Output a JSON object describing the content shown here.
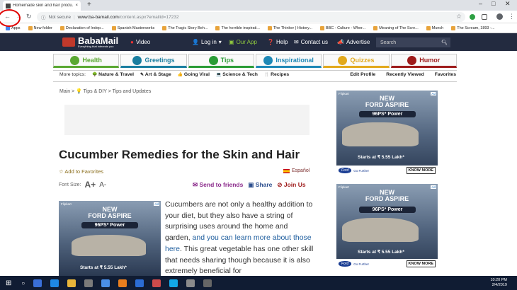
{
  "browser": {
    "tab_title": "Homemade skin and hair produ...",
    "new_tab_symbol": "+",
    "not_secure": "Not secure",
    "url_domain": "www.ba-bamail.com",
    "url_path": "/content.aspx?emailid=17232",
    "bookmarks": [
      "Apps",
      "New folder",
      "Declaration of Indep...",
      "Spanish Masterworks",
      "The Tragic Story Beh...",
      "The horrible inspirati...",
      "The Thinker | History...",
      "BBC - Culture - Wher...",
      "Meaning of The Scre...",
      "Munch",
      "The Scream, 1893 -..."
    ]
  },
  "site": {
    "logo_name": "BabaMail",
    "logo_tagline": "Everything that interests you",
    "video": "Video",
    "login": "Log in",
    "our_app": "Our App",
    "help": "Help",
    "contact": "Contact us",
    "advertise": "Advertise",
    "search_placeholder": "Search",
    "categories": [
      {
        "label": "Health",
        "color": "#5aa832"
      },
      {
        "label": "Greetings",
        "color": "#1a7ea0"
      },
      {
        "label": "Tips",
        "color": "#2a9c36"
      },
      {
        "label": "Inspirational",
        "color": "#1e88b6"
      },
      {
        "label": "Quizzes",
        "color": "#e2a91c"
      },
      {
        "label": "Humor",
        "color": "#9e1b1b"
      }
    ],
    "more_topics_label": "More topics:",
    "more_topics": [
      "Nature & Travel",
      "Art & Stage",
      "Going Viral",
      "Science & Tech",
      "Recipes"
    ],
    "account_links": [
      "Edit Profile",
      "Recently Viewed",
      "Favorites"
    ]
  },
  "article": {
    "breadcrumb": "Main > 💡 Tips & DIY > Tips and Updates",
    "title": "Cucumber Remedies for the Skin and Hair",
    "add_favorites": "☆ Add to Favorites",
    "spanish": "Español",
    "font_size_label": "Font Size:",
    "font_up": "A+",
    "font_down": "A-",
    "send_friends": "Send to friends",
    "share": "Share",
    "join": "Join Us",
    "body_part1": "Cucumbers are not only a healthy addition to your diet, but they also have a string of surprising uses around the home and garden, ",
    "body_link": "and you can learn more about those here",
    "body_part2": ". This great vegetable has one other skill that needs sharing though because it is also extremely beneficial for"
  },
  "ad": {
    "flipkart": "Flipkart",
    "ad_label": "Ad",
    "line1": "NEW",
    "line2": "FORD ASPIRE",
    "power": "96PS* Power",
    "price": "Starts at ₹ 5.55 Lakh*",
    "ford": "Ford",
    "go_further": "Go Further",
    "know_more": "KNOW MORE"
  },
  "taskbar": {
    "time": "10:20 PM",
    "date": "2/4/2019"
  }
}
